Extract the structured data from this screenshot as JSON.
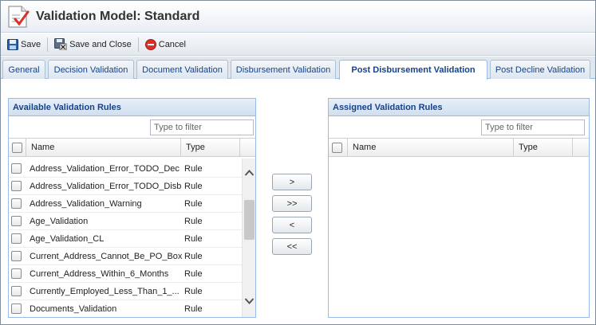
{
  "window": {
    "title": "Validation Model: Standard"
  },
  "toolbar": {
    "save_label": "Save",
    "save_close_label": "Save and Close",
    "cancel_label": "Cancel"
  },
  "tabs": [
    {
      "label": "General"
    },
    {
      "label": "Decision Validation"
    },
    {
      "label": "Document Validation"
    },
    {
      "label": "Disbursement Validation"
    },
    {
      "label": "Post Disbursement Validation",
      "active": true
    },
    {
      "label": "Post Decline Validation"
    }
  ],
  "available": {
    "title": "Available Validation Rules",
    "filter_placeholder": "Type to filter",
    "columns": {
      "name": "Name",
      "type": "Type"
    },
    "rows": [
      {
        "name": "Address_Validation_Error_TODO_Dec",
        "type": "Rule"
      },
      {
        "name": "Address_Validation_Error_TODO_Disb",
        "type": "Rule"
      },
      {
        "name": "Address_Validation_Warning",
        "type": "Rule"
      },
      {
        "name": "Age_Validation",
        "type": "Rule"
      },
      {
        "name": "Age_Validation_CL",
        "type": "Rule"
      },
      {
        "name": "Current_Address_Cannot_Be_PO_Box",
        "type": "Rule"
      },
      {
        "name": "Current_Address_Within_6_Months",
        "type": "Rule"
      },
      {
        "name": "Currently_Employed_Less_Than_1_...",
        "type": "Rule"
      },
      {
        "name": "Documents_Validation",
        "type": "Rule"
      }
    ]
  },
  "assigned": {
    "title": "Assigned Validation Rules",
    "filter_placeholder": "Type to filter",
    "columns": {
      "name": "Name",
      "type": "Type"
    }
  },
  "move_buttons": {
    "add": ">",
    "add_all": ">>",
    "remove": "<",
    "remove_all": "<<"
  },
  "colors": {
    "header_text": "#15428b",
    "border": "#99bbe8",
    "cancel_red": "#d9302c",
    "save_blue": "#2a5ea8"
  }
}
